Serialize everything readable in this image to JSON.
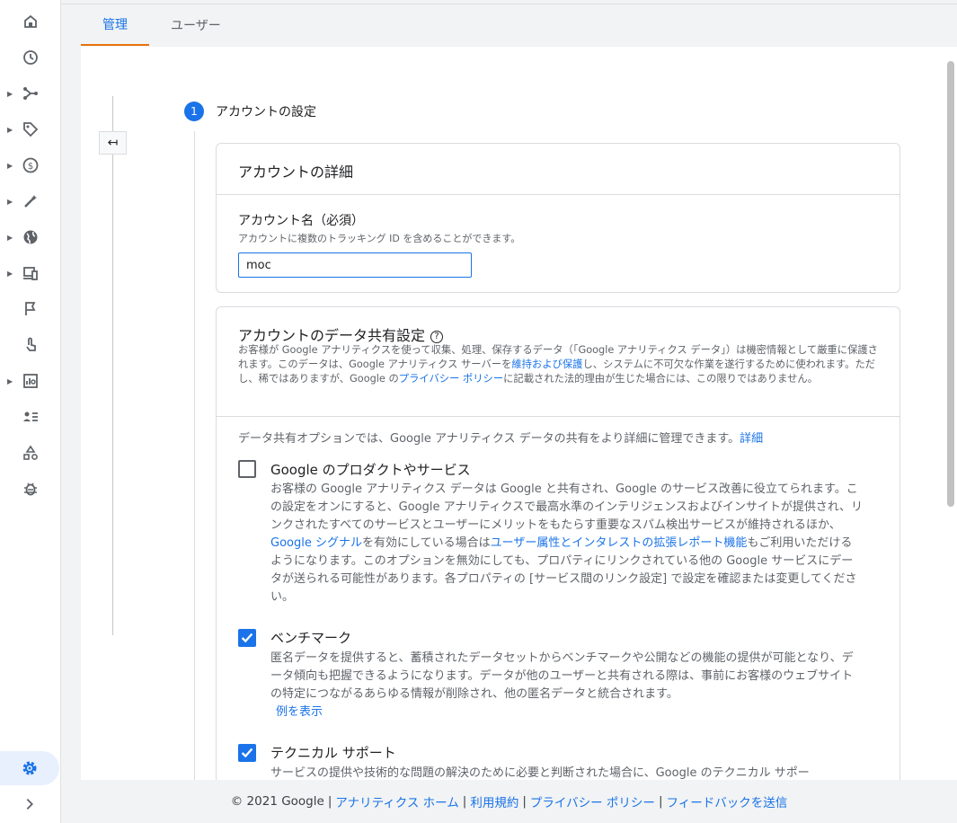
{
  "tabs": [
    {
      "label": "管理"
    },
    {
      "label": "ユーザー"
    }
  ],
  "step": {
    "number": "1",
    "label": "アカウントの設定"
  },
  "details_card": {
    "title": "アカウントの詳細",
    "name_label": "アカウント名（必須）",
    "name_hint": "アカウントに複数のトラッキング ID を含めることができます。",
    "name_value": "moc"
  },
  "sharing_card": {
    "title": "アカウントのデータ共有設定",
    "help_symbol": "?",
    "intro_part1": "お客様が Google アナリティクスを使って収集、処理、保存するデータ（「Google アナリティクス データ」）は機密情報として厳重に保護されます。このデータは、Google アナリティクス サーバーを",
    "intro_link1": "維持および保護",
    "intro_part2": "し、システムに不可欠な作業を遂行するために使われます。ただし、稀ではありますが、Google の",
    "intro_link2": "プライバシー ポリシー",
    "intro_part3": "に記載された法的理由が生じた場合には、この限りではありません。",
    "options_intro": "データ共有オプションでは、Google アナリティクス データの共有をより詳細に管理できます。",
    "options_intro_link": "詳細",
    "options": [
      {
        "title": "Google のプロダクトやサービス",
        "checked": false,
        "desc_part1": "お客様の Google アナリティクス データは Google と共有され、Google のサービス改善に役立てられます。この設定をオンにすると、Google アナリティクスで最高水準のインテリジェンスおよびインサイトが提供され、リンクされたすべてのサービスとユーザーにメリットをもたらす重要なスパム検出サービスが維持されるほか、",
        "desc_link1": "Google シグナル",
        "desc_part2": "を有効にしている場合は",
        "desc_link2": "ユーザー属性とインタレストの拡張レポート機能",
        "desc_part3": "もご利用いただけるようになります。このオプションを無効にしても、プロパティにリンクされている他の Google サービスにデータが送られる可能性があります。各プロパティの [サービス間のリンク設定] で設定を確認または変更してください。"
      },
      {
        "title": "ベンチマーク",
        "checked": true,
        "desc": "匿名データを提供すると、蓄積されたデータセットからベンチマークや公開などの機能の提供が可能となり、データ傾向も把握できるようになります。データが他のユーザーと共有される際は、事前にお客様のウェブサイトの特定につながるあらゆる情報が削除され、他の匿名データと統合されます。",
        "example_link": "例を表示"
      },
      {
        "title": "テクニカル サポート",
        "checked": true,
        "desc": "サービスの提供や技術的な問題の解決のために必要と判断された場合に、Google のテクニカル サポー"
      }
    ]
  },
  "footer": {
    "copyright": "© 2021 Google",
    "sep": "|",
    "links": [
      "アナリティクス ホーム",
      "利用規約",
      "プライバシー ポリシー",
      "フィードバックを送信"
    ]
  },
  "colors": {
    "accent": "#1a73e8",
    "tab_indicator": "#e8710a"
  }
}
